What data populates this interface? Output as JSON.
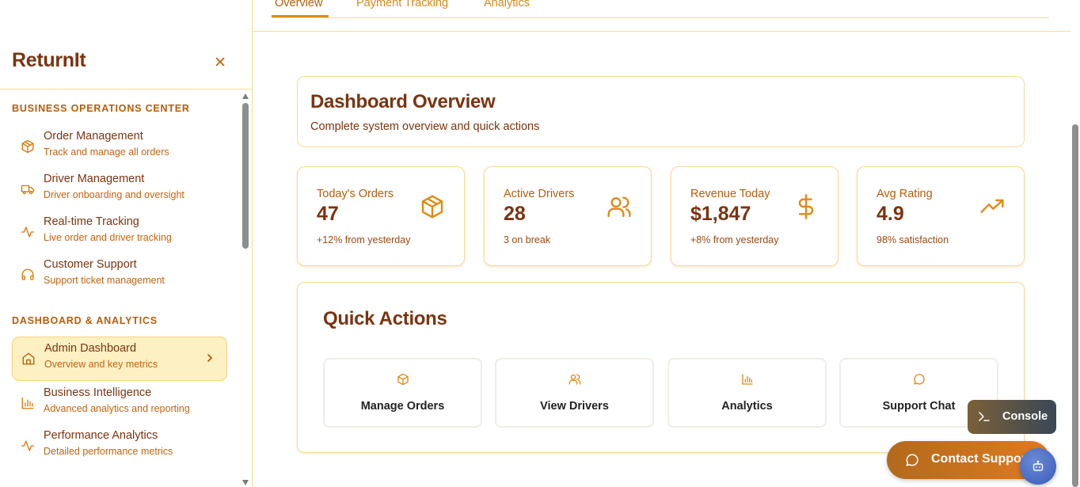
{
  "sidebar": {
    "brand": "ReturnIt",
    "close_label": "×",
    "sections": [
      {
        "title": "BUSINESS OPERATIONS CENTER",
        "items": [
          {
            "label": "Order Management",
            "sub": "Track and manage all orders",
            "icon": "package-icon"
          },
          {
            "label": "Driver Management",
            "sub": "Driver onboarding and oversight",
            "icon": "truck-icon"
          },
          {
            "label": "Real-time Tracking",
            "sub": "Live order and driver tracking",
            "icon": "activity-icon"
          },
          {
            "label": "Customer Support",
            "sub": "Support ticket management",
            "icon": "headphones-icon"
          }
        ]
      },
      {
        "title": "DASHBOARD & ANALYTICS",
        "items": [
          {
            "label": "Admin Dashboard",
            "sub": "Overview and key metrics",
            "icon": "home-icon",
            "active": true
          },
          {
            "label": "Business Intelligence",
            "sub": "Advanced analytics and reporting",
            "icon": "bar-chart-icon"
          },
          {
            "label": "Performance Analytics",
            "sub": "Detailed performance metrics",
            "icon": "activity-icon"
          }
        ]
      }
    ]
  },
  "tabs": [
    {
      "label": "Overview",
      "active": true
    },
    {
      "label": "Payment Tracking"
    },
    {
      "label": "Analytics"
    }
  ],
  "overview": {
    "title": "Dashboard Overview",
    "subtitle": "Complete system overview and quick actions"
  },
  "stats": [
    {
      "label": "Today's Orders",
      "value": "47",
      "note": "+12% from yesterday",
      "icon": "package-icon"
    },
    {
      "label": "Active Drivers",
      "value": "28",
      "note": "3 on break",
      "icon": "users-icon"
    },
    {
      "label": "Revenue Today",
      "value": "$1,847",
      "note": "+8% from yesterday",
      "icon": "dollar-icon"
    },
    {
      "label": "Avg Rating",
      "value": "4.9",
      "note": "98% satisfaction",
      "icon": "trending-up-icon"
    }
  ],
  "quick_actions": {
    "title": "Quick Actions",
    "items": [
      {
        "label": "Manage Orders",
        "icon": "package-icon"
      },
      {
        "label": "View Drivers",
        "icon": "users-icon"
      },
      {
        "label": "Analytics",
        "icon": "bar-chart-icon"
      },
      {
        "label": "Support Chat",
        "icon": "message-circle-icon"
      }
    ]
  },
  "floating": {
    "console_label": "Console",
    "contact_label": "Contact Support"
  },
  "colors": {
    "accent": "#e08a16",
    "heading": "#7a3410",
    "active_bg": "#fdf0c3",
    "border": "#f6dc98"
  }
}
